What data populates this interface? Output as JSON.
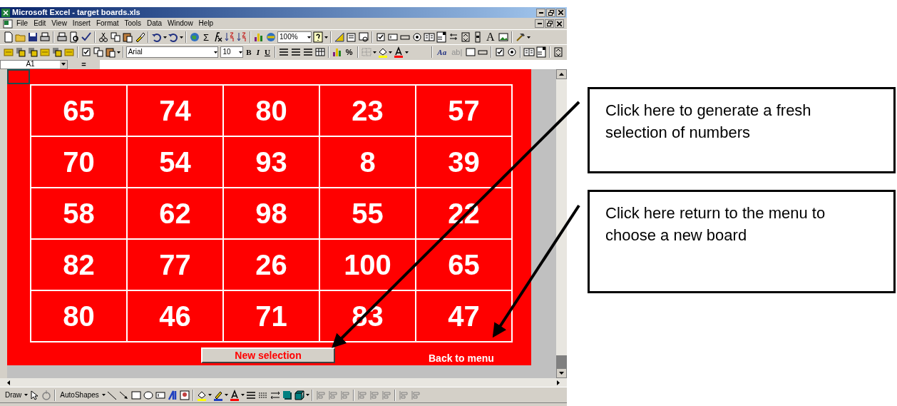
{
  "window": {
    "title": "Microsoft Excel - target boards.xls"
  },
  "menu_bar": [
    {
      "label": "File"
    },
    {
      "label": "Edit"
    },
    {
      "label": "View"
    },
    {
      "label": "Insert"
    },
    {
      "label": "Format"
    },
    {
      "label": "Tools"
    },
    {
      "label": "Data"
    },
    {
      "label": "Window"
    },
    {
      "label": "Help"
    }
  ],
  "standard_toolbar": {
    "autosum": "Σ",
    "zoom": "100%",
    "label_tool": "A"
  },
  "formatting_toolbar": {
    "font": "Arial",
    "size": "10",
    "bold": "B",
    "italic": "I",
    "underline": "U",
    "percent": "%",
    "label_control": "Aa",
    "edit_box": "ab|"
  },
  "formula_bar": {
    "name_box": "A1",
    "equals": "="
  },
  "board": {
    "rows": [
      [
        "65",
        "74",
        "80",
        "23",
        "57"
      ],
      [
        "70",
        "54",
        "93",
        "8",
        "39"
      ],
      [
        "58",
        "62",
        "98",
        "55",
        "22"
      ],
      [
        "82",
        "77",
        "26",
        "100",
        "65"
      ],
      [
        "80",
        "46",
        "71",
        "83",
        "47"
      ]
    ]
  },
  "buttons": [
    {
      "kind": "button",
      "label": "New selection"
    },
    {
      "kind": "link",
      "label": "Back to menu"
    }
  ],
  "drawing_toolbar": {
    "draw": "Draw",
    "autoshapes": "AutoShapes"
  },
  "callouts": [
    {
      "text": "Click here to generate a fresh selection of numbers"
    },
    {
      "text": "Click here return to the menu to choose a new board"
    }
  ]
}
